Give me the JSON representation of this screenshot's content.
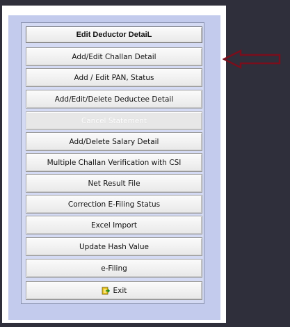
{
  "header": {
    "label": "Edit Deductor DetaiL"
  },
  "menu": [
    {
      "label": "Add/Edit Challan Detail",
      "enabled": true
    },
    {
      "label": "Add / Edit PAN, Status",
      "enabled": true
    },
    {
      "label": "Add/Edit/Delete Deductee Detail",
      "enabled": true
    },
    {
      "label": "Cancel Statement",
      "enabled": false
    },
    {
      "label": "Add/Delete Salary Detail",
      "enabled": true
    },
    {
      "label": "Multiple Challan Verification with CSI",
      "enabled": true
    },
    {
      "label": "Net Result File",
      "enabled": true
    },
    {
      "label": "Correction E-Filing Status",
      "enabled": true
    },
    {
      "label": "Excel Import",
      "enabled": true
    },
    {
      "label": "Update Hash Value",
      "enabled": true
    },
    {
      "label": "e-Filing",
      "enabled": true
    },
    {
      "label": "Exit",
      "enabled": true,
      "icon": "exit-door-icon"
    }
  ],
  "annotation": {
    "icon": "left-arrow-icon",
    "color": "#7a0e1c"
  },
  "colors": {
    "background": "#2f2f3b",
    "panel": "#c3cbed",
    "button": "#f4f4f4"
  }
}
